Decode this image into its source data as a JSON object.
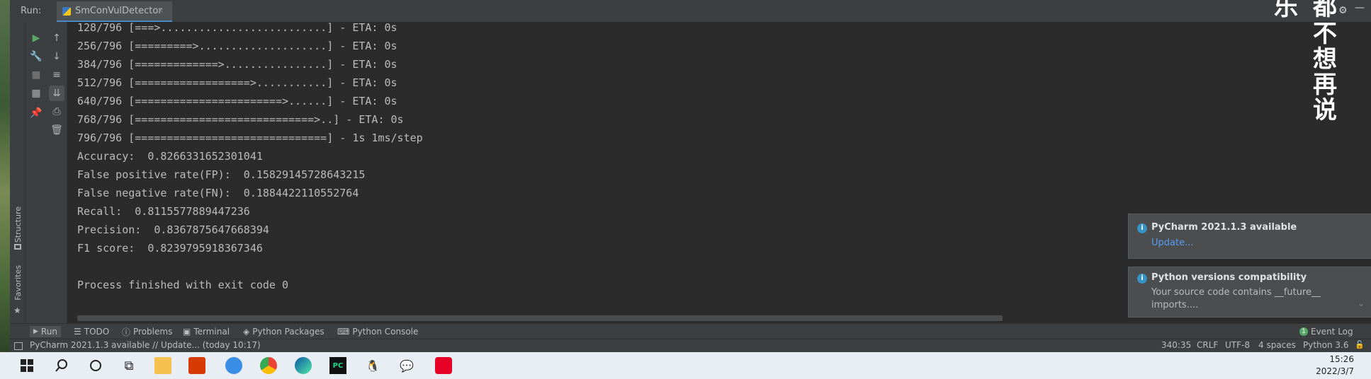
{
  "run_panel": {
    "label": "Run:",
    "tab": "SmConVulDetector",
    "tab_close": "×"
  },
  "side_labels": {
    "structure": "Structure",
    "favorites": "Favorites"
  },
  "console": {
    "lines": [
      "128/796 [===>..........................] - ETA: 0s",
      "256/796 [=========>....................] - ETA: 0s",
      "384/796 [=============>................] - ETA: 0s",
      "512/796 [==================>...........] - ETA: 0s",
      "640/796 [=======================>......] - ETA: 0s",
      "768/796 [============================>..] - ETA: 0s",
      "796/796 [==============================] - 1s 1ms/step",
      "Accuracy:  0.8266331652301041",
      "False positive rate(FP):  0.15829145728643215",
      "False negative rate(FN):  0.1884422110552764",
      "Recall:  0.8115577889447236",
      "Precision:  0.8367875647668394",
      "F1 score:  0.8239795918367346",
      "",
      "Process finished with exit code 0"
    ]
  },
  "overlay_text": {
    "col1": [
      "乐"
    ],
    "col2": [
      "都",
      "不",
      "想",
      "再",
      "说"
    ]
  },
  "notifications": [
    {
      "title": "PyCharm 2021.1.3 available",
      "link": "Update..."
    },
    {
      "title": "Python versions compatibility",
      "body1": "Your source code contains __future__",
      "body2": "imports...."
    }
  ],
  "tool_tabs": {
    "run": "Run",
    "todo": "TODO",
    "problems": "Problems",
    "terminal": "Terminal",
    "packages": "Python Packages",
    "pyconsole": "Python Console",
    "event_log": "Event Log",
    "event_count": "1"
  },
  "status_bar": {
    "message": "PyCharm 2021.1.3 available // Update... (today 10:17)",
    "position": "340:35",
    "line_sep": "CRLF",
    "encoding": "UTF-8",
    "indent": "4 spaces",
    "interpreter": "Python 3.6"
  },
  "taskbar": {
    "time": "15:26",
    "date": "2022/3/7",
    "icons": [
      "windows-icon",
      "search-icon",
      "cortana-icon",
      "task-view-icon",
      "file-explorer-icon",
      "office-icon",
      "vscode-like-icon",
      "chrome-icon",
      "edge-icon",
      "pycharm-icon",
      "qq-icon",
      "wechat-icon",
      "netease-music-icon"
    ]
  },
  "colors": {
    "console_bg": "#2b2b2b",
    "panel_bg": "#3c3f41",
    "text": "#bbbbbb",
    "link": "#589df6",
    "accent": "#3592c4"
  }
}
